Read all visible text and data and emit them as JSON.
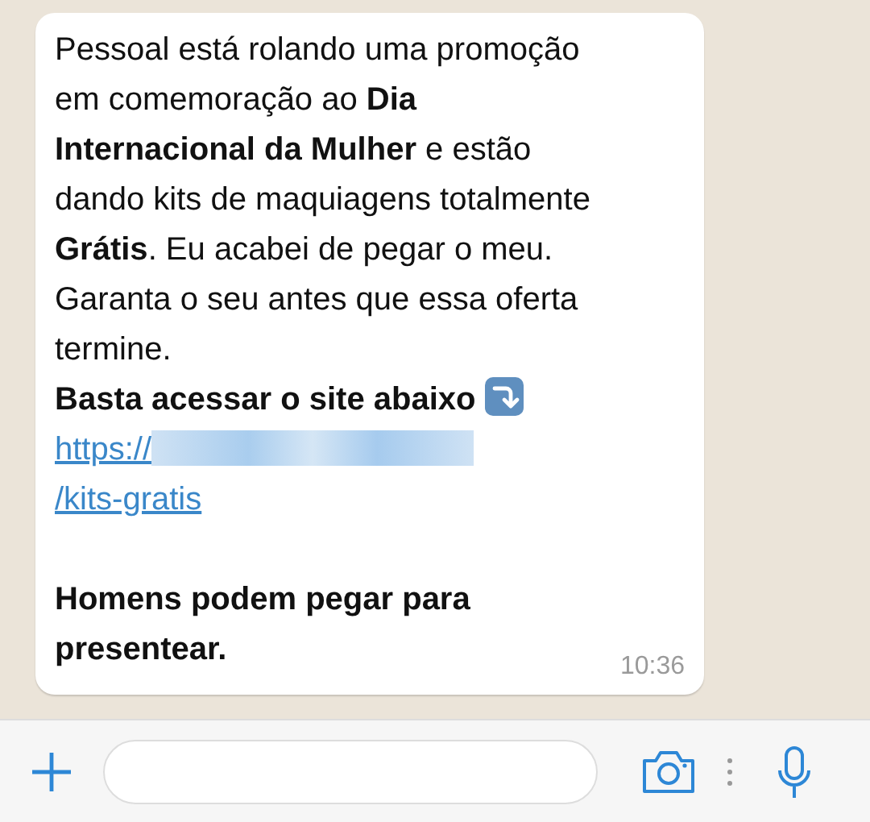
{
  "message": {
    "paragraphs": [
      {
        "kind": "text",
        "text": "Pessoal está rolando uma promoção em comemoração ao **Dia Internacional da Mulher** e estão dando kits de maquiagens totalmente **Grátis**. Eu acabei de pegar o meu. Garanta o seu antes que essa oferta termine."
      },
      {
        "kind": "bold",
        "text": "Basta acessar o site abaixo"
      },
      {
        "kind": "link",
        "prefix": "https://",
        "suffix": "/kits-gratis"
      },
      {
        "kind": "blank"
      },
      {
        "kind": "bold",
        "text": "Homens podem pegar para presentear."
      }
    ],
    "time": "10:36"
  }
}
